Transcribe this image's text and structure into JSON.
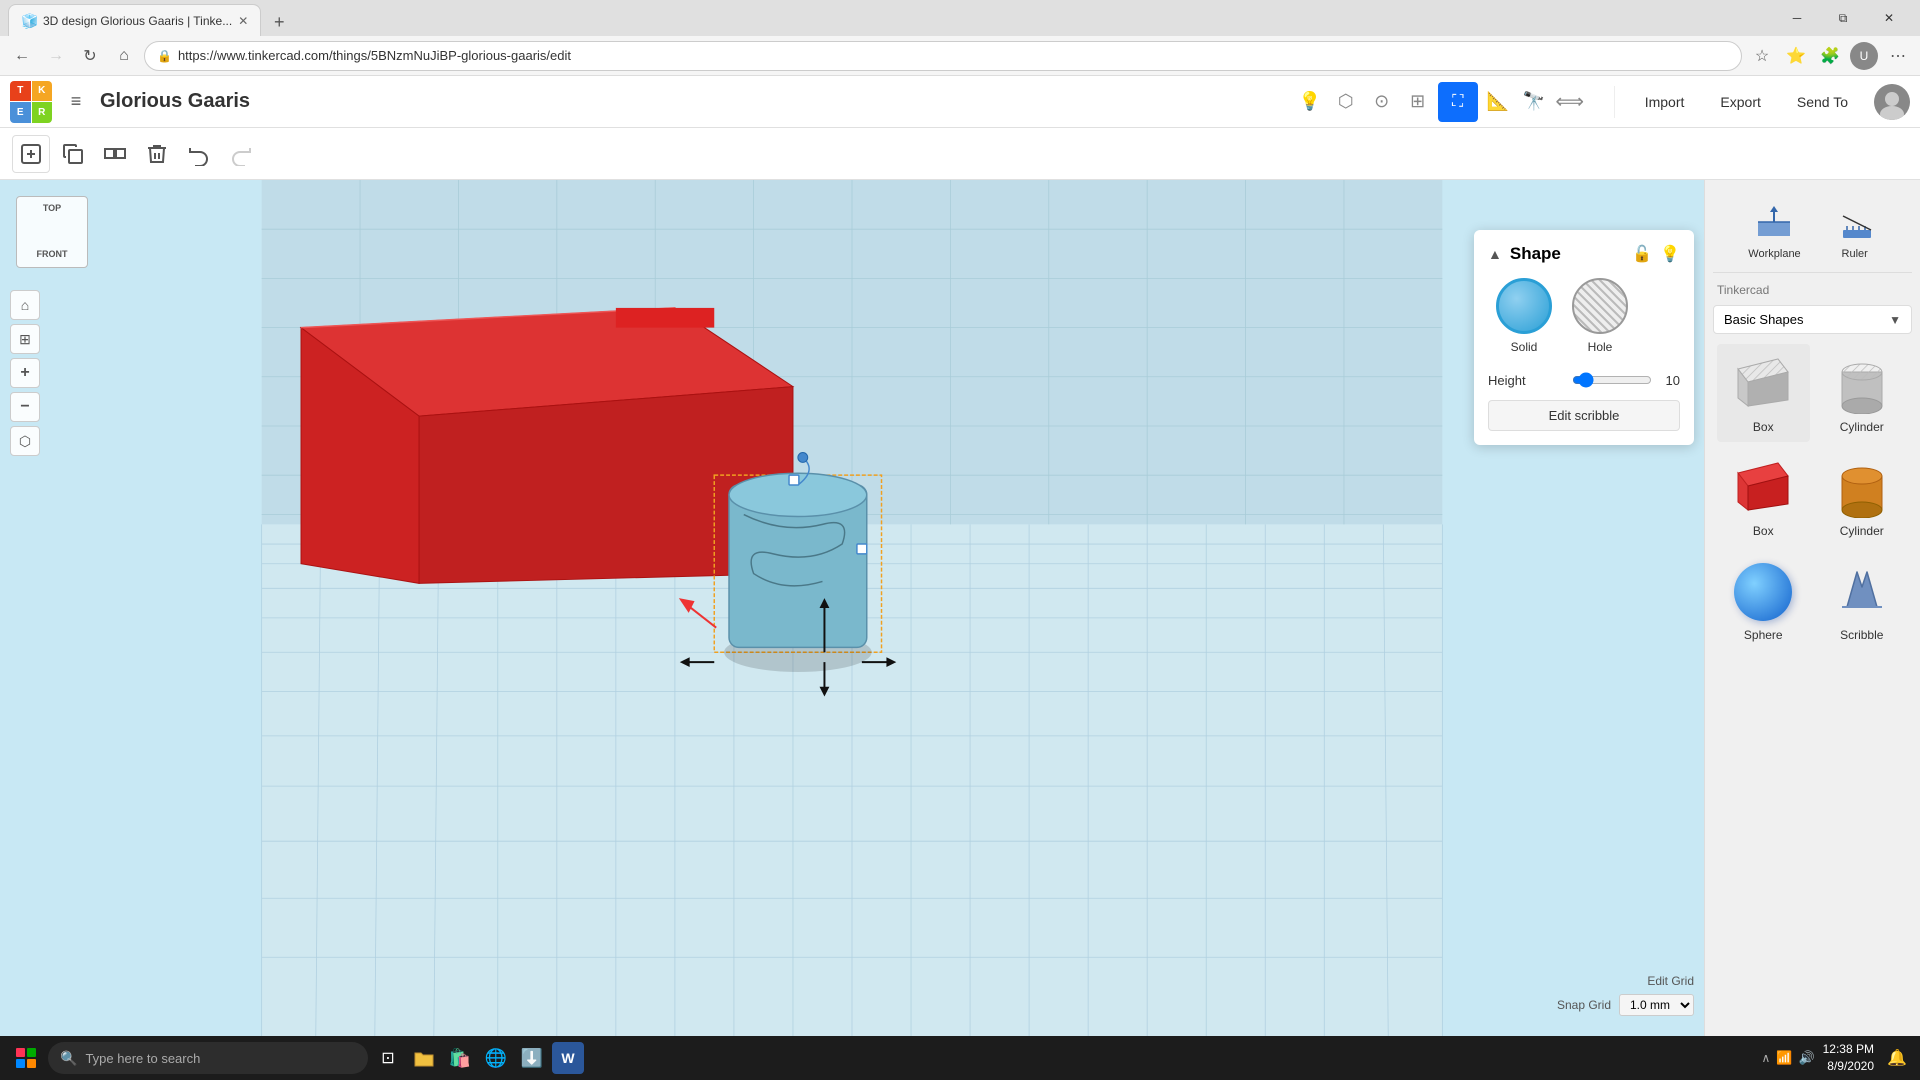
{
  "browser": {
    "tab_title": "3D design Glorious Gaaris | Tinke...",
    "url": "https://www.tinkercad.com/things/5BNzmNuJiBP-glorious-gaaris/edit",
    "favicon": "🧊"
  },
  "app": {
    "logo_letters": [
      "T",
      "K",
      "E",
      "R"
    ],
    "project_name": "Glorious Gaaris",
    "header_actions": [
      "Import",
      "Export",
      "Send To"
    ],
    "view_labels": {
      "top": "TOP",
      "front": "FRONT"
    }
  },
  "shape_panel": {
    "title": "Shape",
    "solid_label": "Solid",
    "hole_label": "Hole",
    "height_label": "Height",
    "height_value": "10",
    "edit_scribble_label": "Edit scribble"
  },
  "right_panel": {
    "tools": [
      {
        "label": "Workplane",
        "icon": "⊞"
      },
      {
        "label": "Ruler",
        "icon": "📏"
      }
    ],
    "section_title": "Tinkercad",
    "dropdown_label": "Basic Shapes",
    "shapes": [
      {
        "name": "Box",
        "type": "box-gray"
      },
      {
        "name": "Cylinder",
        "type": "cyl-gray"
      },
      {
        "name": "Box",
        "type": "box-red"
      },
      {
        "name": "Cylinder",
        "type": "cyl-orange"
      },
      {
        "name": "Sphere",
        "type": "sphere-blue"
      },
      {
        "name": "Scribble",
        "type": "scribble"
      }
    ]
  },
  "canvas": {
    "edit_grid_label": "Edit Grid",
    "snap_grid_label": "Snap Grid",
    "snap_value": "1.0 mm"
  },
  "taskbar": {
    "search_placeholder": "Type here to search",
    "time": "12:38 PM",
    "date": "8/9/2020"
  }
}
